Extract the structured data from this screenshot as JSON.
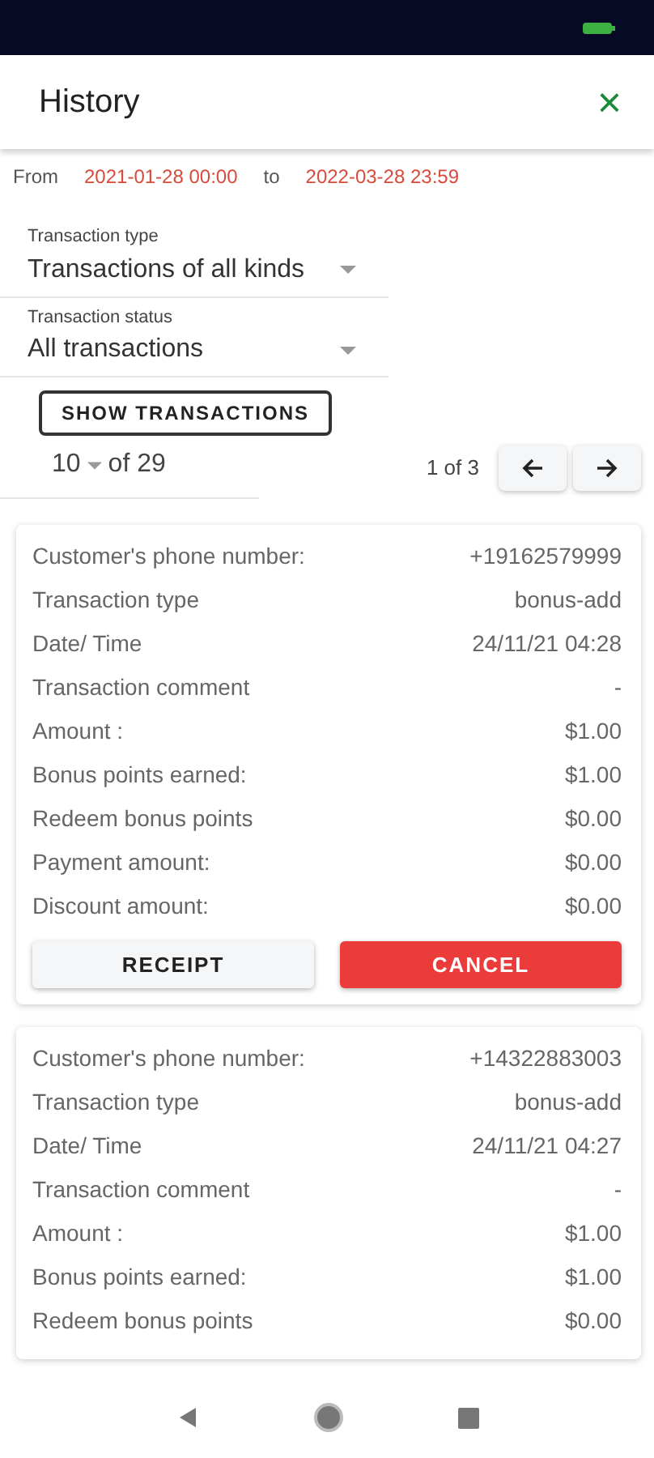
{
  "header": {
    "title": "History",
    "close": "×"
  },
  "date_range": {
    "from_label": "From",
    "from": "2021-01-28 00:00",
    "to_label": "to",
    "to": "2022-03-28 23:59"
  },
  "filters": [
    {
      "label": "Transaction type",
      "value": "Transactions of all kinds"
    },
    {
      "label": "Transaction status",
      "value": "All transactions"
    }
  ],
  "show_button": "SHOW TRANSACTIONS",
  "pager": {
    "page_size": "10",
    "of_total": "of 29",
    "page": "1 of 3"
  },
  "transactions": [
    {
      "fields": [
        {
          "label": "Customer's phone number:",
          "value": "+19162579999"
        },
        {
          "label": "Transaction type",
          "value": "bonus-add"
        },
        {
          "label": "Date/ Time",
          "value": "24/11/21 04:28"
        },
        {
          "label": "Transaction comment",
          "value": "-"
        },
        {
          "label": "Amount :",
          "value": "$1.00"
        },
        {
          "label": "Bonus points earned:",
          "value": "$1.00"
        },
        {
          "label": "Redeem bonus points",
          "value": "$0.00"
        },
        {
          "label": "Payment amount:",
          "value": "$0.00"
        },
        {
          "label": "Discount amount:",
          "value": "$0.00"
        }
      ],
      "buttons": [
        "RECEIPT",
        "CANCEL"
      ]
    },
    {
      "fields": [
        {
          "label": "Customer's phone number:",
          "value": "+14322883003"
        },
        {
          "label": "Transaction type",
          "value": "bonus-add"
        },
        {
          "label": "Date/ Time",
          "value": "24/11/21 04:27"
        },
        {
          "label": "Transaction comment",
          "value": "-"
        },
        {
          "label": "Amount :",
          "value": "$1.00"
        },
        {
          "label": "Bonus points earned:",
          "value": "$1.00"
        },
        {
          "label": "Redeem bonus points",
          "value": "$0.00"
        }
      ]
    }
  ]
}
